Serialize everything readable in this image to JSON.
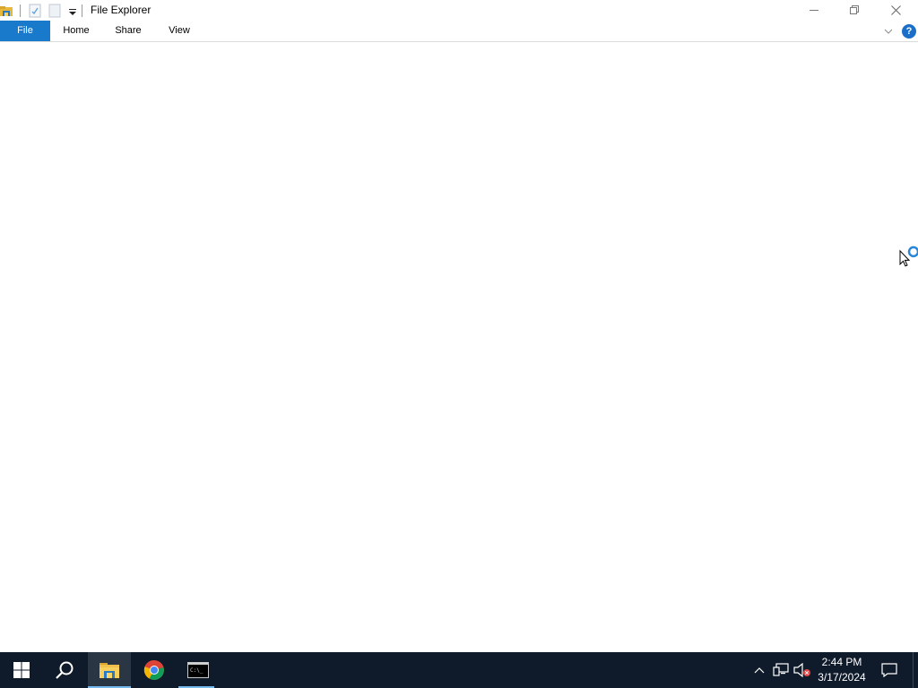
{
  "window": {
    "title": "File Explorer",
    "quick_access_icons": [
      "file-explorer-icon",
      "properties-icon",
      "new-folder-icon",
      "customize-dropdown-icon"
    ]
  },
  "ribbon": {
    "tabs": [
      {
        "label": "File",
        "active": true
      },
      {
        "label": "Home"
      },
      {
        "label": "Share"
      },
      {
        "label": "View"
      }
    ],
    "help_label": "?"
  },
  "taskbar": {
    "apps": [
      {
        "name": "start",
        "icon": "windows-logo-icon"
      },
      {
        "name": "search",
        "icon": "search-icon"
      },
      {
        "name": "file-explorer",
        "icon": "folder-icon",
        "active": true
      },
      {
        "name": "chrome",
        "icon": "chrome-icon"
      },
      {
        "name": "command-prompt",
        "icon": "terminal-icon"
      }
    ],
    "clock": {
      "time": "2:44 PM",
      "date": "3/17/2024"
    },
    "tray_icons": [
      "chevron-up-icon",
      "network-icon",
      "volume-muted-icon",
      "notification-icon"
    ]
  },
  "colors": {
    "accent": "#1979ca",
    "taskbar_bg": "#0f1a2a",
    "taskbar_active": "#2b3644",
    "taskbar_underline": "#76b9ed"
  }
}
